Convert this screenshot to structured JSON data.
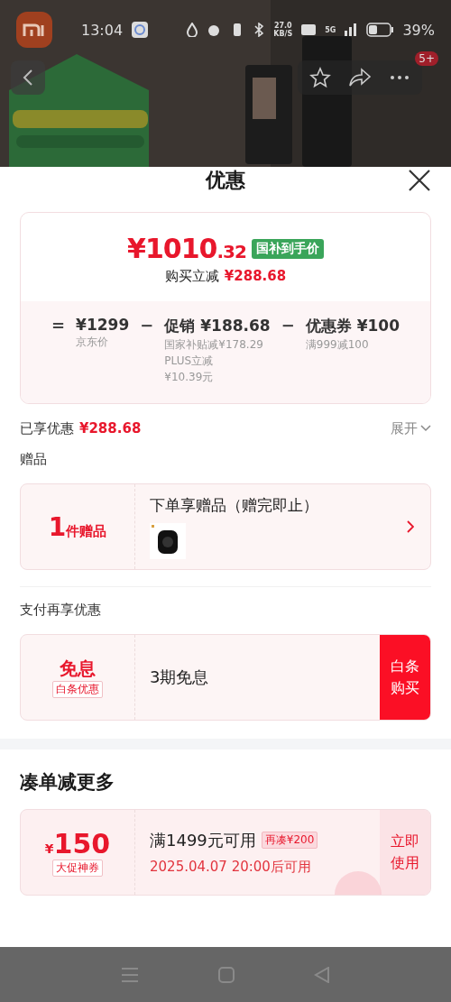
{
  "status_bar": {
    "time": "13:04",
    "net_speed": "27.0",
    "net_unit": "KB/S",
    "network": "5G",
    "battery": "39%"
  },
  "header": {
    "badge": "5+"
  },
  "sheet": {
    "title": "优惠"
  },
  "price_card": {
    "currency": "¥",
    "price_int": "1010",
    "price_dec": ".32",
    "tag": "国补到手价",
    "saving_label": "购买立减",
    "saving": "¥288.68",
    "breakdown": [
      {
        "op": "=",
        "value": "¥1299",
        "notes": [
          "京东价"
        ]
      },
      {
        "op": "−",
        "value": "促销 ¥188.68",
        "notes": [
          "国家补贴减¥178.29",
          "PLUS立减",
          "¥10.39元"
        ]
      },
      {
        "op": "−",
        "value": "优惠券 ¥100",
        "notes": [
          "满999减100"
        ]
      }
    ]
  },
  "enjoyed": {
    "label": "已享优惠",
    "amount": "¥288.68",
    "toggle": "展开",
    "expanded": false
  },
  "gifts": {
    "section": "赠品",
    "count": "1",
    "unit": "件赠品",
    "title": "下单享赠品（赠完即止）"
  },
  "payment": {
    "section": "支付再享优惠",
    "big": "免息",
    "tag": "白条优惠",
    "desc": "3期免息",
    "button": "白条购买"
  },
  "bundle": {
    "title": "凑单减更多",
    "coupon": {
      "currency": "¥",
      "amount": "150",
      "tag": "大促神券",
      "condition": "满1499元可用",
      "chip": "再凑¥200",
      "validity": "2025.04.07 20:00后可用",
      "button": "立即使用",
      "claimed": true
    }
  }
}
